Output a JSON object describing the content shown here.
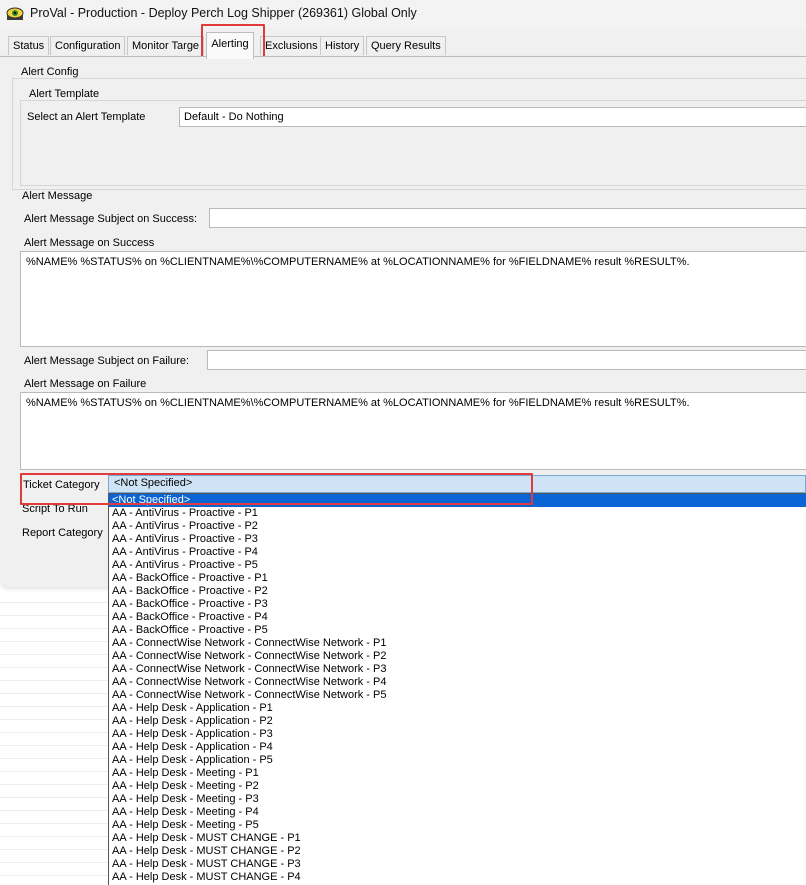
{
  "window": {
    "title": "ProVal - Production - Deploy Perch Log Shipper (269361) Global Only"
  },
  "tabs": [
    {
      "label": "Status",
      "active": false
    },
    {
      "label": "Configuration",
      "active": false
    },
    {
      "label": "Monitor Targe",
      "active": false
    },
    {
      "label": "Alerting",
      "active": true
    },
    {
      "label": "Exclusions",
      "active": false
    },
    {
      "label": "History",
      "active": false
    },
    {
      "label": "Query Results",
      "active": false
    }
  ],
  "alert_config": {
    "group_label": "Alert Config",
    "template_group_label": "Alert Template",
    "select_template_label": "Select an Alert Template",
    "select_template_value": "Default - Do Nothing"
  },
  "alert_message": {
    "section_label": "Alert Message",
    "subject_success_label": "Alert Message Subject on Success:",
    "subject_success_value": "",
    "success_label": "Alert Message on Success",
    "success_value": "%NAME% %STATUS% on %CLIENTNAME%\\%COMPUTERNAME% at %LOCATIONNAME% for %FIELDNAME% result %RESULT%.",
    "subject_failure_label": "Alert Message Subject on Failure:",
    "subject_failure_value": "",
    "failure_label": "Alert Message on Failure",
    "failure_value": "%NAME% %STATUS% on %CLIENTNAME%\\%COMPUTERNAME% at %LOCATIONNAME% for %FIELDNAME% result %RESULT%."
  },
  "ticket_category": {
    "label": "Ticket Category",
    "selected": "<Not Specified>",
    "options": [
      "<Not Specified>",
      "AA - AntiVirus - Proactive - P1",
      "AA - AntiVirus - Proactive - P2",
      "AA - AntiVirus - Proactive - P3",
      "AA - AntiVirus - Proactive - P4",
      "AA - AntiVirus - Proactive - P5",
      "AA - BackOffice - Proactive - P1",
      "AA - BackOffice - Proactive - P2",
      "AA - BackOffice - Proactive - P3",
      "AA - BackOffice - Proactive - P4",
      "AA - BackOffice - Proactive - P5",
      "AA - ConnectWise Network - ConnectWise Network - P1",
      "AA - ConnectWise Network - ConnectWise Network - P2",
      "AA - ConnectWise Network - ConnectWise Network - P3",
      "AA - ConnectWise Network - ConnectWise Network - P4",
      "AA - ConnectWise Network - ConnectWise Network - P5",
      "AA - Help Desk - Application - P1",
      "AA - Help Desk - Application - P2",
      "AA - Help Desk - Application - P3",
      "AA - Help Desk - Application - P4",
      "AA - Help Desk - Application - P5",
      "AA - Help Desk - Meeting - P1",
      "AA - Help Desk - Meeting - P2",
      "AA - Help Desk - Meeting - P3",
      "AA - Help Desk - Meeting - P4",
      "AA - Help Desk - Meeting - P5",
      "AA - Help Desk - MUST CHANGE - P1",
      "AA - Help Desk - MUST CHANGE - P2",
      "AA - Help Desk - MUST CHANGE - P3",
      "AA - Help Desk - MUST CHANGE - P4"
    ]
  },
  "script_to_run": {
    "label": "Script To Run"
  },
  "report_category": {
    "label": "Report Category"
  },
  "colors": {
    "highlight": "#e03a3a",
    "selection": "#0a64d6",
    "combo_bg": "#cfe3f6"
  },
  "icons": {
    "app": "proval-eye-icon"
  }
}
